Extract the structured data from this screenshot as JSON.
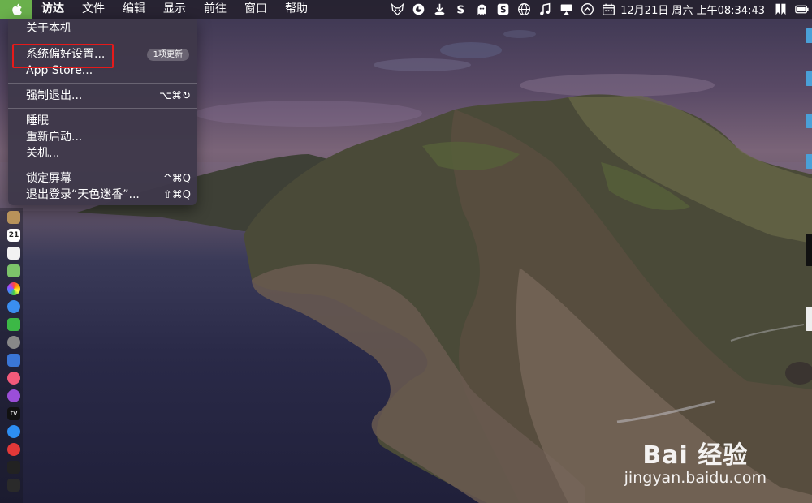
{
  "menubar": {
    "apple_icon": "apple-logo-icon",
    "items": [
      "访达",
      "文件",
      "编辑",
      "显示",
      "前往",
      "窗口",
      "帮助"
    ],
    "status_icons": [
      "fox-icon",
      "circle-app-icon",
      "download-icon",
      "s-app-icon",
      "ghost-icon",
      "s-box-icon",
      "globe-icon",
      "music-note-icon",
      "airplay-icon",
      "clock-icon",
      "calendar-icon"
    ],
    "clock": "12月21日 周六 上午08:34:43",
    "extra_icons": [
      "bookmark-icon",
      "battery-icon"
    ]
  },
  "apple_menu": {
    "about": "关于本机",
    "system_prefs": "系统偏好设置...",
    "update_badge": "1项更新",
    "app_store": "App Store...",
    "force_quit": "强制退出...",
    "force_quit_shortcut": "⌥⌘↻",
    "sleep": "睡眠",
    "restart": "重新启动...",
    "shutdown": "关机...",
    "lock_screen": "锁定屏幕",
    "lock_shortcut": "^⌘Q",
    "logout": "退出登录“天色迷香”...",
    "logout_shortcut": "⇧⌘Q"
  },
  "dock": {
    "icons": [
      "notes-icon",
      "calendar-icon",
      "reminders-icon",
      "maps-icon",
      "photos-icon",
      "messages-icon",
      "wechat-icon",
      "system-prefs-icon",
      "keynote-icon",
      "music-icon",
      "podcasts-icon",
      "tv-icon",
      "app-store-icon",
      "vivaldi-icon",
      "terminal-icon",
      "activity-monitor-icon"
    ],
    "calendar_day": "21",
    "tv_label": "tv"
  },
  "watermark": {
    "logo": "Bai 经验",
    "url": "jingyan.baidu.com"
  },
  "colors": {
    "apple_button": "#6ab04c",
    "highlight_box": "#e61a1a",
    "menu_bg": "#3e384a"
  }
}
